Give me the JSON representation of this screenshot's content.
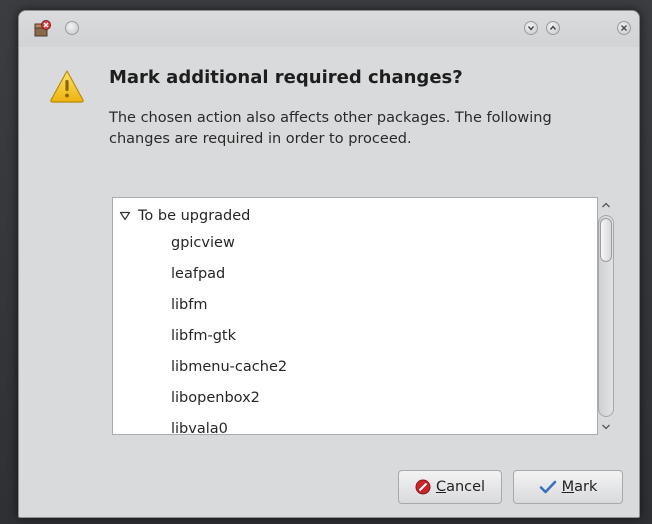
{
  "dialog": {
    "title_bar": {
      "app_icon": "package-manager-icon",
      "buttons": [
        "minimize-icon",
        "maximize-icon",
        "close-icon"
      ]
    },
    "icon": "warning-icon",
    "heading": "Mark additional required changes?",
    "description": "The chosen action also affects other packages. The following changes are required in order to proceed.",
    "changes": {
      "group_label": "To be upgraded",
      "group_expanded": true,
      "items": [
        "gpicview",
        "leafpad",
        "libfm",
        "libfm-gtk",
        "libmenu-cache2",
        "libopenbox2",
        "libvala0"
      ]
    },
    "buttons": {
      "cancel": {
        "mnemonic": "C",
        "rest": "ancel",
        "icon": "cancel-icon"
      },
      "mark": {
        "mnemonic": "M",
        "rest": "ark",
        "icon": "checkmark-icon"
      }
    }
  },
  "colors": {
    "window_bg": "#d9dadc",
    "warning_yellow": "#f2c31a",
    "cancel_red": "#c8262c",
    "mark_blue": "#3c6fc0"
  }
}
